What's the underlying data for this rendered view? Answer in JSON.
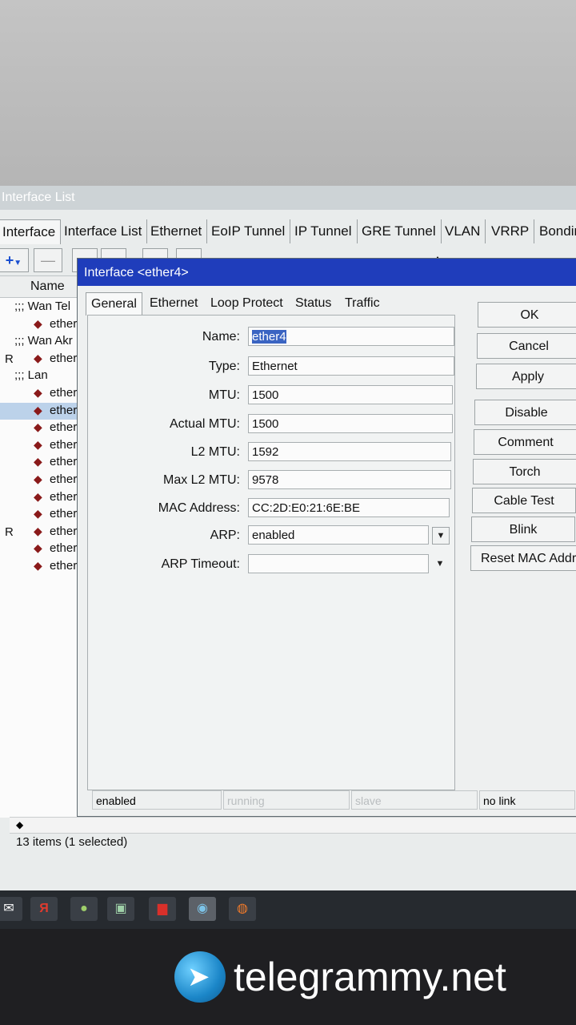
{
  "main": {
    "title": "Interface List",
    "tabs": [
      "Interface",
      "Interface List",
      "Ethernet",
      "EoIP Tunnel",
      "IP Tunnel",
      "GRE Tunnel",
      "VLAN",
      "VRRP",
      "Bondin"
    ],
    "toolbar": {
      "add": "+",
      "remove": "—"
    },
    "column_name": "Name",
    "rows": [
      {
        "flag": "",
        "group": ";;; Wan Tel",
        "name": ""
      },
      {
        "flag": "",
        "group": "",
        "name": "ether"
      },
      {
        "flag": "",
        "group": ";;; Wan Akr",
        "name": ""
      },
      {
        "flag": "R",
        "group": "",
        "name": "ether"
      },
      {
        "flag": "",
        "group": ";;; Lan",
        "name": ""
      },
      {
        "flag": "",
        "group": "",
        "name": "ether"
      },
      {
        "flag": "",
        "group": "",
        "name": "ether",
        "selected": true
      },
      {
        "flag": "",
        "group": "",
        "name": "ether"
      },
      {
        "flag": "",
        "group": "",
        "name": "ether"
      },
      {
        "flag": "",
        "group": "",
        "name": "ether"
      },
      {
        "flag": "",
        "group": "",
        "name": "ether"
      },
      {
        "flag": "",
        "group": "",
        "name": "ether"
      },
      {
        "flag": "",
        "group": "",
        "name": "ether"
      },
      {
        "flag": "R",
        "group": "",
        "name": "ether"
      },
      {
        "flag": "",
        "group": "",
        "name": "ether"
      },
      {
        "flag": "",
        "group": "",
        "name": "ether"
      }
    ],
    "status": "13 items (1 selected)"
  },
  "dialog": {
    "title": "Interface <ether4>",
    "tabs": [
      "General",
      "Ethernet",
      "Loop Protect",
      "Status",
      "Traffic"
    ],
    "fields": {
      "name_label": "Name:",
      "name": "ether4",
      "type_label": "Type:",
      "type": "Ethernet",
      "mtu_label": "MTU:",
      "mtu": "1500",
      "actual_mtu_label": "Actual MTU:",
      "actual_mtu": "1500",
      "l2mtu_label": "L2 MTU:",
      "l2mtu": "1592",
      "max_l2mtu_label": "Max L2 MTU:",
      "max_l2mtu": "9578",
      "mac_label": "MAC Address:",
      "mac": "CC:2D:E0:21:6E:BE",
      "arp_label": "ARP:",
      "arp": "enabled",
      "arp_timeout_label": "ARP Timeout:",
      "arp_timeout": ""
    },
    "buttons": [
      "OK",
      "Cancel",
      "Apply",
      "Disable",
      "Comment",
      "Torch",
      "Cable Test",
      "Blink",
      "Reset MAC Addres"
    ],
    "status_bar": [
      "enabled",
      "running",
      "slave",
      "no link"
    ]
  },
  "watermark": {
    "text": "telegrammy.net"
  }
}
